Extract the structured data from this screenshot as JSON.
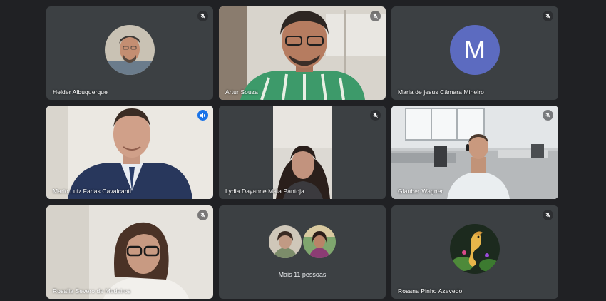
{
  "participants": [
    {
      "name": "Helder Albuquerque",
      "muted": true,
      "display": "photo-avatar"
    },
    {
      "name": "Artur Souza",
      "muted": true,
      "display": "video"
    },
    {
      "name": "Maria de jesus Câmara Mineiro",
      "muted": true,
      "display": "letter-avatar",
      "initial": "M",
      "avatar_color": "#5c6bc0"
    },
    {
      "name": "Mario Luiz Farias Cavalcanti",
      "muted": false,
      "speaking": true,
      "display": "video"
    },
    {
      "name": "Lydia Dayanne Maia Pantoja",
      "muted": true,
      "display": "video"
    },
    {
      "name": "Glauber Wagner",
      "muted": true,
      "display": "video"
    },
    {
      "name": "Rosalia Severo de Medeiros",
      "muted": true,
      "display": "video"
    },
    {
      "name": "",
      "display": "overflow",
      "more_label": "Mais 11 pessoas"
    },
    {
      "name": "Rosana Pinho Azevedo",
      "muted": true,
      "display": "photo-avatar"
    }
  ],
  "colors": {
    "background": "#202124",
    "tile": "#3c4043",
    "speaking_border": "#8ab4f8",
    "speaking_badge": "#1a73e8"
  }
}
